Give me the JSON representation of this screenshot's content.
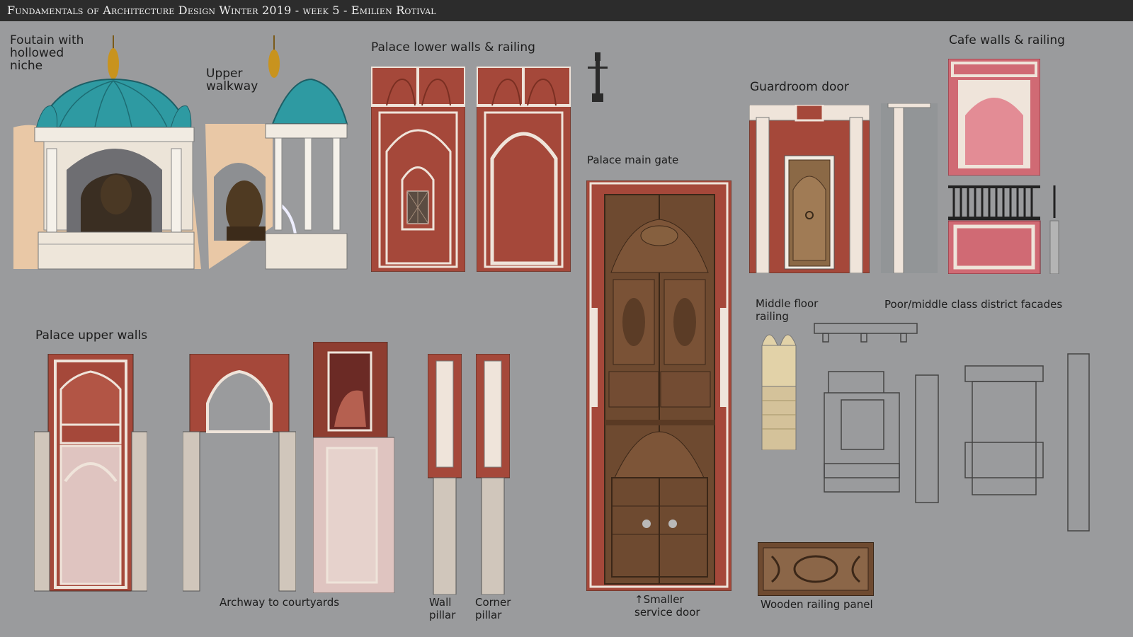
{
  "title": "Fundamentals of Architecture Design Winter 2019 - week 5 - Emilien Rotival",
  "labels": {
    "fountain": "Foutain with\nhollowed\nniche",
    "walkway": "Upper\nwalkway",
    "lower_walls": "Palace lower walls & railing",
    "main_gate": "Palace main gate",
    "guardroom": "Guardroom door",
    "cafe": "Cafe walls & railing",
    "upper_walls": "Palace upper walls",
    "archway": "Archway to courtyards",
    "wall_pillar": "Wall\npillar",
    "corner_pillar": "Corner\npillar",
    "service_door": "↑Smaller\n service door",
    "middle_floor": "Middle floor\nrailing",
    "facades": "Poor/middle class district facades",
    "railing_panel": "Wooden railing panel"
  },
  "colors": {
    "background": "#9a9b9d",
    "title_bar": "#2c2c2c",
    "red_wall": "#a5483a",
    "trim": "#efe4da",
    "pink": "#d06a74",
    "teal_dome": "#2e9aa2",
    "wood": "#6e4a30",
    "sandstone": "#e2d2a8"
  },
  "icons": [
    "dome-icon",
    "arch-icon",
    "pillar-icon",
    "lattice-icon",
    "balustrade-icon",
    "lamp-post-icon"
  ]
}
